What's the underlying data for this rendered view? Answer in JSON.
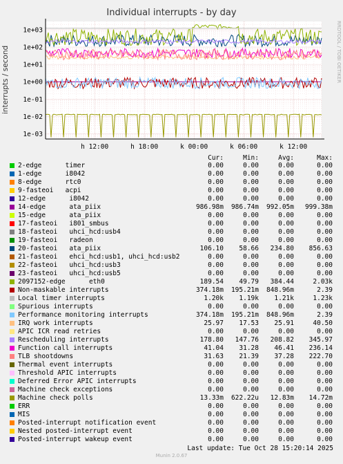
{
  "chart_data": {
    "type": "line",
    "title": "Individual interrupts - by day",
    "ylabel": "interrupts / second",
    "yscale": "log",
    "ylim": [
      0.0005,
      3000
    ],
    "ytick_labels": [
      "1e+03",
      "1e+02",
      "1e+01",
      "1e+00",
      "1e-01",
      "1e-02",
      "1e-03"
    ],
    "ytick_values": [
      1000,
      100,
      10,
      1,
      0.1,
      0.01,
      0.001
    ],
    "xtick_labels": [
      "h 12:00",
      "h 18:00",
      "k 00:00",
      "k 06:00",
      "k 12:00"
    ],
    "grid": true,
    "columns": [
      "Cur:",
      "Min:",
      "Avg:",
      "Max:"
    ],
    "colors": {
      "background": "#f0f0f0",
      "plot": "#ffffff",
      "grid": "#e0b0b0"
    },
    "series": [
      {
        "name": "2-edge      timer",
        "color": "#00cc00",
        "cur": "0.00",
        "min": "0.00",
        "avg": "0.00",
        "max": "0.00"
      },
      {
        "name": "1-edge      i8042",
        "color": "#0066b3",
        "cur": "0.00",
        "min": "0.00",
        "avg": "0.00",
        "max": "0.00"
      },
      {
        "name": "8-edge      rtc0",
        "color": "#ff8000",
        "cur": "0.00",
        "min": "0.00",
        "avg": "0.00",
        "max": "0.00"
      },
      {
        "name": "9-fasteoi   acpi",
        "color": "#ffcc00",
        "cur": "0.00",
        "min": "0.00",
        "avg": "0.00",
        "max": "0.00"
      },
      {
        "name": "12-edge      i8042",
        "color": "#330099",
        "cur": "0.00",
        "min": "0.00",
        "avg": "0.00",
        "max": "0.00"
      },
      {
        "name": "14-edge      ata_piix",
        "color": "#990099",
        "cur": "986.98m",
        "min": "986.74m",
        "avg": "992.05m",
        "max": "999.38m"
      },
      {
        "name": "15-edge      ata_piix",
        "color": "#ccff00",
        "cur": "0.00",
        "min": "0.00",
        "avg": "0.00",
        "max": "0.00"
      },
      {
        "name": "17-fasteoi   i801_smbus",
        "color": "#ff0000",
        "cur": "0.00",
        "min": "0.00",
        "avg": "0.00",
        "max": "0.00"
      },
      {
        "name": "18-fasteoi   uhci_hcd:usb4",
        "color": "#808080",
        "cur": "0.00",
        "min": "0.00",
        "avg": "0.00",
        "max": "0.00"
      },
      {
        "name": "19-fasteoi   radeon",
        "color": "#008f00",
        "cur": "0.00",
        "min": "0.00",
        "avg": "0.00",
        "max": "0.00"
      },
      {
        "name": "20-fasteoi   ata_piix",
        "color": "#00487d",
        "cur": "106.10",
        "min": "58.66",
        "avg": "234.80",
        "max": "856.63"
      },
      {
        "name": "21-fasteoi   ehci_hcd:usb1, uhci_hcd:usb2",
        "color": "#b35a00",
        "cur": "0.00",
        "min": "0.00",
        "avg": "0.00",
        "max": "0.00"
      },
      {
        "name": "22-fasteoi   uhci_hcd:usb3",
        "color": "#b38f00",
        "cur": "0.00",
        "min": "0.00",
        "avg": "0.00",
        "max": "0.00"
      },
      {
        "name": "23-fasteoi   uhci_hcd:usb5",
        "color": "#6b006b",
        "cur": "0.00",
        "min": "0.00",
        "avg": "0.00",
        "max": "0.00"
      },
      {
        "name": "2097152-edge      eth0",
        "color": "#8fb300",
        "cur": "189.54",
        "min": "49.79",
        "avg": "384.44",
        "max": "2.03k"
      },
      {
        "name": "Non-maskable interrupts",
        "color": "#b30000",
        "cur": "374.18m",
        "min": "195.21m",
        "avg": "848.96m",
        "max": "2.39"
      },
      {
        "name": "Local timer interrupts",
        "color": "#bebebe",
        "cur": "1.20k",
        "min": "1.19k",
        "avg": "1.21k",
        "max": "1.23k"
      },
      {
        "name": "Spurious interrupts",
        "color": "#80ff80",
        "cur": "0.00",
        "min": "0.00",
        "avg": "0.00",
        "max": "0.00"
      },
      {
        "name": "Performance monitoring interrupts",
        "color": "#80c9ff",
        "cur": "374.18m",
        "min": "195.21m",
        "avg": "848.96m",
        "max": "2.39"
      },
      {
        "name": "IRQ work interrupts",
        "color": "#ffc080",
        "cur": "25.97",
        "min": "17.53",
        "avg": "25.91",
        "max": "40.50"
      },
      {
        "name": "APIC ICR read retries",
        "color": "#ffe680",
        "cur": "0.00",
        "min": "0.00",
        "avg": "0.00",
        "max": "0.00"
      },
      {
        "name": "Rescheduling interrupts",
        "color": "#aa80ff",
        "cur": "178.80",
        "min": "147.76",
        "avg": "208.82",
        "max": "345.97"
      },
      {
        "name": "Function call interrupts",
        "color": "#ee00cc",
        "cur": "41.04",
        "min": "31.28",
        "avg": "46.41",
        "max": "236.14"
      },
      {
        "name": "TLB shootdowns",
        "color": "#ff8080",
        "cur": "31.63",
        "min": "21.39",
        "avg": "37.28",
        "max": "222.70"
      },
      {
        "name": "Thermal event interrupts",
        "color": "#666600",
        "cur": "0.00",
        "min": "0.00",
        "avg": "0.00",
        "max": "0.00"
      },
      {
        "name": "Threshold APIC interrupts",
        "color": "#ffbfff",
        "cur": "0.00",
        "min": "0.00",
        "avg": "0.00",
        "max": "0.00"
      },
      {
        "name": "Deferred Error APIC interrupts",
        "color": "#00ffcc",
        "cur": "0.00",
        "min": "0.00",
        "avg": "0.00",
        "max": "0.00"
      },
      {
        "name": "Machine check exceptions",
        "color": "#cc6699",
        "cur": "0.00",
        "min": "0.00",
        "avg": "0.00",
        "max": "0.00"
      },
      {
        "name": "Machine check polls",
        "color": "#999900",
        "cur": "13.33m",
        "min": "622.22u",
        "avg": "12.83m",
        "max": "14.72m"
      },
      {
        "name": "ERR",
        "color": "#00cc00",
        "cur": "0.00",
        "min": "0.00",
        "avg": "0.00",
        "max": "0.00"
      },
      {
        "name": "MIS",
        "color": "#0066b3",
        "cur": "0.00",
        "min": "0.00",
        "avg": "0.00",
        "max": "0.00"
      },
      {
        "name": "Posted-interrupt notification event",
        "color": "#ff8000",
        "cur": "0.00",
        "min": "0.00",
        "avg": "0.00",
        "max": "0.00"
      },
      {
        "name": "Nested posted-interrupt event",
        "color": "#ffcc00",
        "cur": "0.00",
        "min": "0.00",
        "avg": "0.00",
        "max": "0.00"
      },
      {
        "name": "Posted-interrupt wakeup event",
        "color": "#330099",
        "cur": "0.00",
        "min": "0.00",
        "avg": "0.00",
        "max": "0.00"
      }
    ]
  },
  "last_update": "Last update: Tue Oct 28 15:20:14 2025",
  "footer": "Munin 2.0.67",
  "side_text": "RRDTOOL / TOBI OETIKER"
}
